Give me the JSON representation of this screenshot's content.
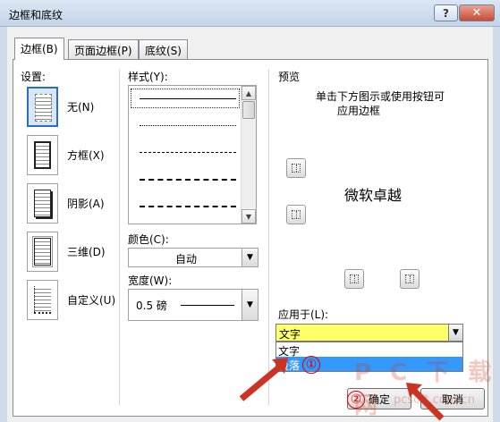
{
  "window": {
    "title": "边框和底纹",
    "help_label": "?",
    "close_label": "✕"
  },
  "tabs": [
    {
      "label": "边框(B)"
    },
    {
      "label": "页面边框(P)"
    },
    {
      "label": "底纹(S)"
    }
  ],
  "settings": {
    "heading": "设置:",
    "items": [
      {
        "label": "无(N)",
        "icon": "border-none-icon"
      },
      {
        "label": "方框(X)",
        "icon": "border-box-icon"
      },
      {
        "label": "阴影(A)",
        "icon": "border-shadow-icon"
      },
      {
        "label": "三维(D)",
        "icon": "border-3d-icon"
      },
      {
        "label": "自定义(U)",
        "icon": "border-custom-icon"
      }
    ]
  },
  "style": {
    "heading": "样式(Y):"
  },
  "color": {
    "heading": "颜色(C):",
    "value": "自动"
  },
  "width": {
    "heading": "宽度(W):",
    "value": "0.5 磅"
  },
  "preview": {
    "heading": "预览",
    "hint_line1": "单击下方图示或使用按钮可",
    "hint_line2": "应用边框",
    "sample_text": "微软卓越"
  },
  "apply_to": {
    "heading": "应用于(L):",
    "value": "文字",
    "options": [
      "文字",
      "段落"
    ]
  },
  "buttons": {
    "ok": "确定",
    "cancel": "取消"
  },
  "overlay": {
    "watermark": "P C 下 载 网",
    "url": "pcsoft.com.cn",
    "marker1": "①",
    "marker2": "②"
  },
  "colors": {
    "apply_highlight": "#ffff66",
    "dropdown_selection": "#3399ff",
    "annotation": "#cc3322"
  }
}
